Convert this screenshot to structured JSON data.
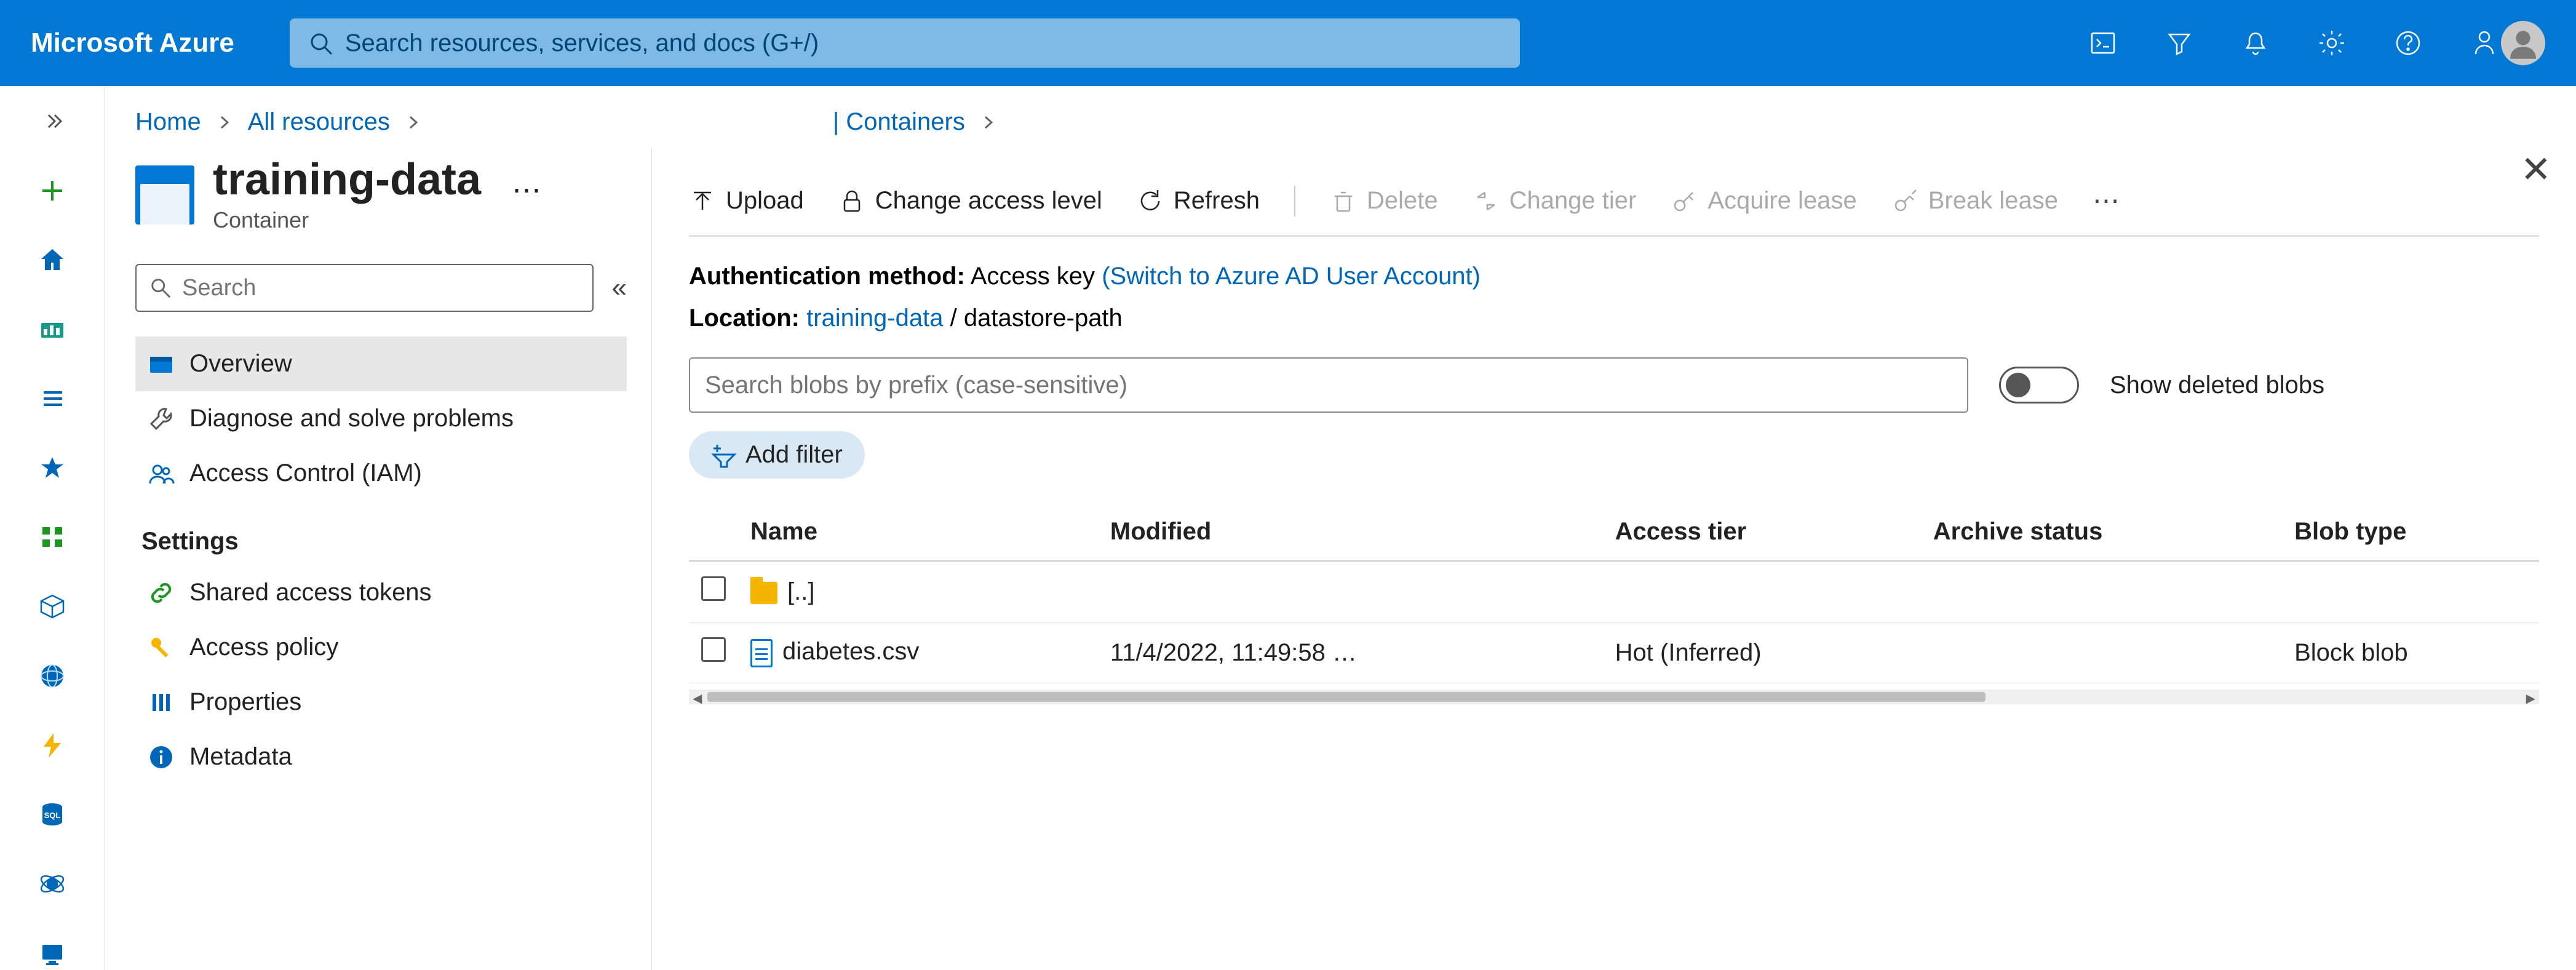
{
  "brand": "Microsoft Azure",
  "search_placeholder": "Search resources, services, and docs (G+/)",
  "breadcrumb": {
    "home": "Home",
    "all_resources": "All resources",
    "containers": "| Containers"
  },
  "page": {
    "title": "training-data",
    "subtitle": "Container"
  },
  "nav_search_placeholder": "Search",
  "nav": {
    "overview": "Overview",
    "diagnose": "Diagnose and solve problems",
    "iam": "Access Control (IAM)",
    "settings_header": "Settings",
    "sas": "Shared access tokens",
    "access_policy": "Access policy",
    "properties": "Properties",
    "metadata": "Metadata"
  },
  "toolbar": {
    "upload": "Upload",
    "change_access": "Change access level",
    "refresh": "Refresh",
    "delete": "Delete",
    "change_tier": "Change tier",
    "acquire_lease": "Acquire lease",
    "break_lease": "Break lease"
  },
  "meta": {
    "auth_label": "Authentication method:",
    "auth_value": "Access key",
    "auth_switch": "(Switch to Azure AD User Account)",
    "loc_label": "Location:",
    "loc_link": "training-data",
    "loc_path": "datastore-path"
  },
  "blob_search_placeholder": "Search blobs by prefix (case-sensitive)",
  "toggle_label": "Show deleted blobs",
  "add_filter": "Add filter",
  "columns": {
    "name": "Name",
    "modified": "Modified",
    "access_tier": "Access tier",
    "archive_status": "Archive status",
    "blob_type": "Blob type"
  },
  "rows": [
    {
      "name": "[..]",
      "kind": "folder",
      "modified": "",
      "access_tier": "",
      "archive_status": "",
      "blob_type": ""
    },
    {
      "name": "diabetes.csv",
      "kind": "file",
      "modified": "11/4/2022, 11:49:58 …",
      "access_tier": "Hot (Inferred)",
      "archive_status": "",
      "blob_type": "Block blob"
    }
  ]
}
